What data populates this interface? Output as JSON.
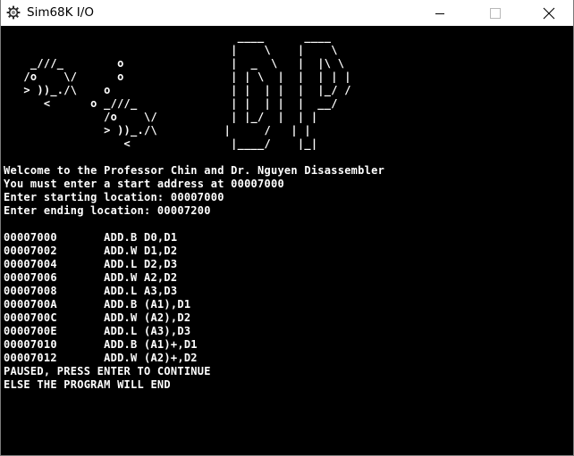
{
  "window": {
    "title": "Sim68K I/O",
    "app_icon": "gear-icon",
    "controls": {
      "minimize_icon": "minimize-icon",
      "maximize_icon": "maximize-icon",
      "close_icon": "close-icon"
    }
  },
  "console": {
    "background": "#000000",
    "foreground": "#ffffff",
    "lines": [
      "                                   ____      ____",
      "                                  |    \\    |    \\",
      "    _///_        o                |  _  \\   |  |\\ \\",
      "   /o    \\/      o                | | \\  |  |  | | |",
      "   > ))_./\\    o                  | |  | |  |  |_/ /",
      "      <      o _///_              | |  | |  |  __/",
      "               /o    \\/           | |_/  |  | |",
      "               > ))_./\\          |     /   | |",
      "                  <               |____/    |_|",
      "",
      "Welcome to the Professor Chin and Dr. Nguyen Disassembler",
      "You must enter a start address at 00007000",
      "Enter starting location: 00007000",
      "Enter ending location: 00007200",
      "",
      "00007000       ADD.B D0,D1",
      "00007002       ADD.W D1,D2",
      "00007004       ADD.L D2,D3",
      "00007006       ADD.W A2,D2",
      "00007008       ADD.L A3,D3",
      "0000700A       ADD.B (A1),D1",
      "0000700C       ADD.W (A2),D2",
      "0000700E       ADD.L (A3),D3",
      "00007010       ADD.B (A1)+,D1",
      "00007012       ADD.W (A2)+,D2",
      "PAUSED, PRESS ENTER TO CONTINUE",
      "ELSE THE PROGRAM WILL END"
    ]
  }
}
